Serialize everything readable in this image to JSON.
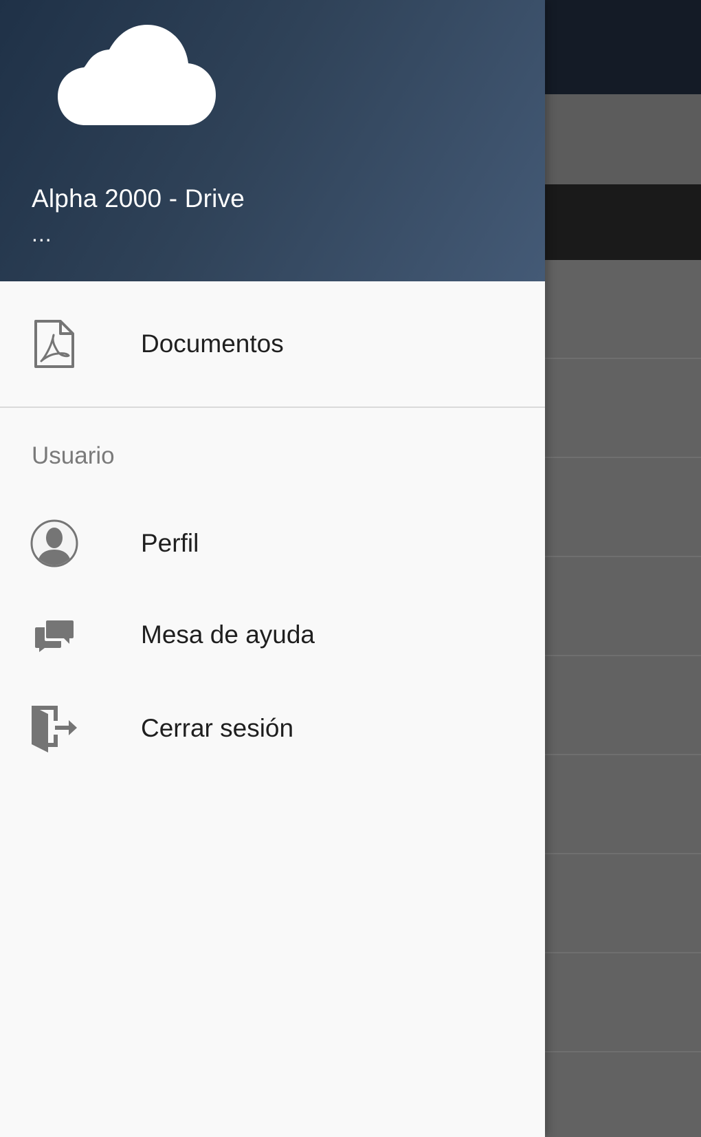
{
  "drawer": {
    "header": {
      "logo_icon": "cloud-icon",
      "title": "Alpha 2000 - Drive",
      "subtitle": "..."
    },
    "items": [
      {
        "label": "Documentos",
        "icon": "pdf-document-icon"
      }
    ],
    "sections": [
      {
        "title": "Usuario",
        "items": [
          {
            "label": "Perfil",
            "icon": "user-profile-icon"
          },
          {
            "label": "Mesa de ayuda",
            "icon": "chat-bubbles-icon"
          },
          {
            "label": "Cerrar sesión",
            "icon": "logout-icon"
          }
        ]
      }
    ]
  },
  "colors": {
    "header_gradient_start": "#1f3147",
    "header_gradient_end": "#445a76",
    "drawer_background": "#f9f9f9",
    "icon_gray": "#757575",
    "text_primary": "#1f1f1f",
    "text_section": "#7a7a7a"
  }
}
